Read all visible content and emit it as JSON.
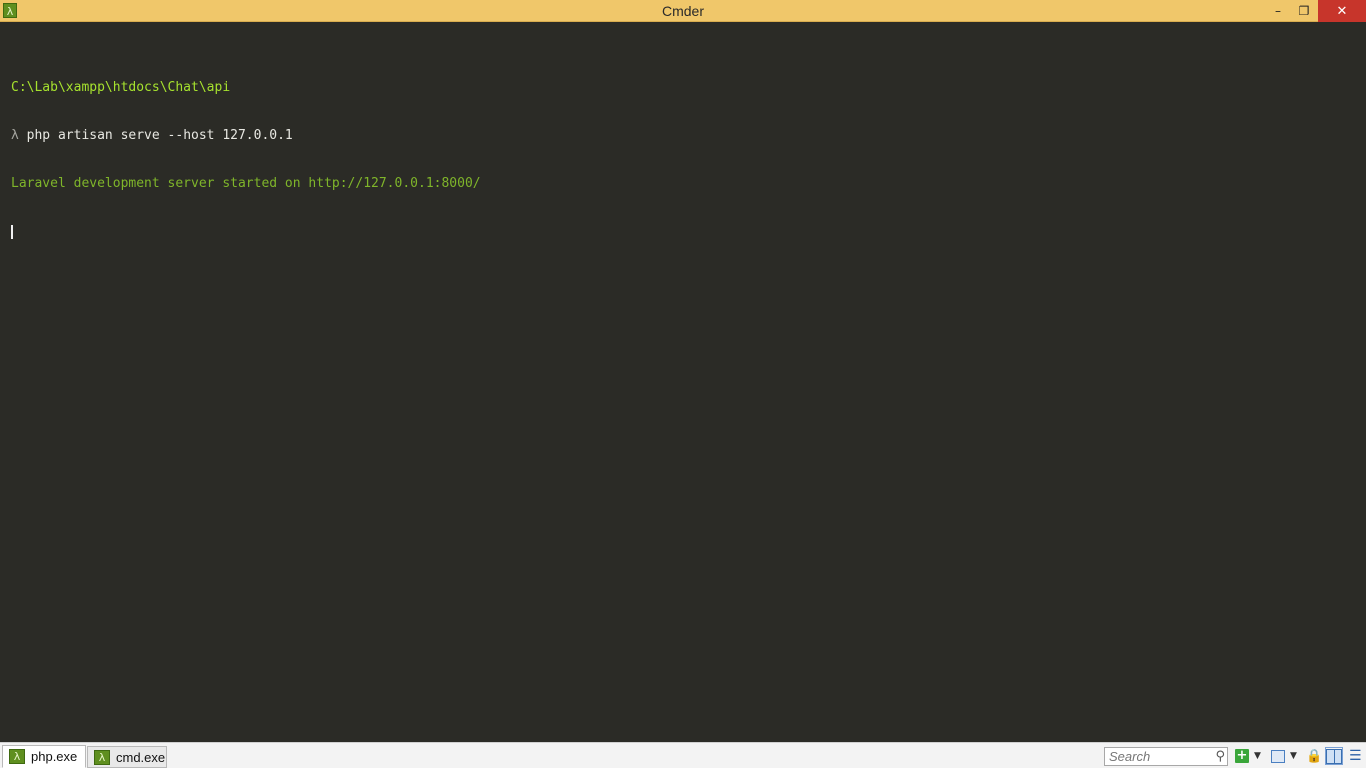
{
  "window": {
    "title": "Cmder",
    "app_icon_glyph": "λ",
    "controls": {
      "minimize": "–",
      "maximize": "❐",
      "close": "✕"
    }
  },
  "terminal": {
    "lines": [
      {
        "type": "path",
        "text": "C:\\Lab\\xampp\\htdocs\\Chat\\api"
      },
      {
        "type": "prompt",
        "prompt": "λ",
        "command": " php artisan serve --host 127.0.0.1"
      },
      {
        "type": "output",
        "text": "Laravel development server started on http://127.0.0.1:8000/"
      }
    ],
    "colors": {
      "background": "#2b2b26",
      "path": "#a6e22e",
      "command": "#e8e8e2",
      "output": "#7fb52a"
    }
  },
  "tabs": [
    {
      "label": "php.exe",
      "icon": "lambda-icon",
      "active": true
    },
    {
      "label": "cmd.exe",
      "icon": "lambda-icon",
      "active": false
    }
  ],
  "toolbar": {
    "search_placeholder": "Search",
    "search_icon": "magnifier-icon",
    "icons": [
      "plus-icon",
      "dropdown-icon",
      "layout-icon",
      "dropdown-icon",
      "lock-icon",
      "split-view-icon",
      "menu-icon"
    ]
  }
}
